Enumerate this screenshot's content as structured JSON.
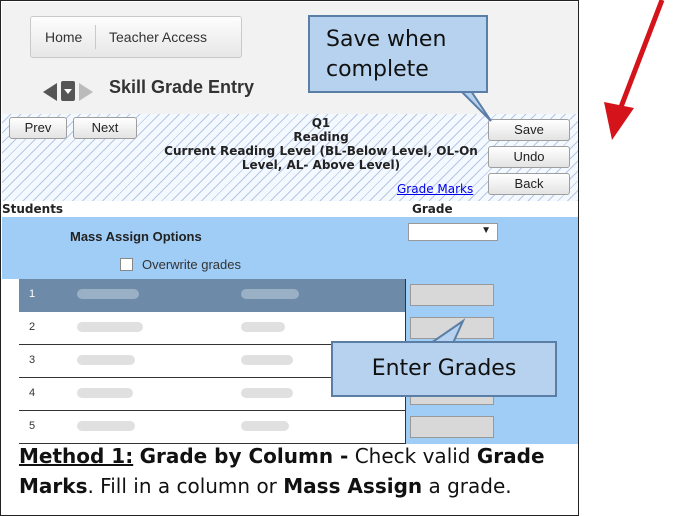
{
  "nav": {
    "home": "Home",
    "teacher_access": "Teacher Access"
  },
  "page_title": "Skill Grade Entry",
  "toolbar": {
    "prev": "Prev",
    "next": "Next",
    "save": "Save",
    "undo": "Undo",
    "back": "Back"
  },
  "heading": {
    "term": "Q1",
    "subject": "Reading",
    "skill": "Current Reading Level (BL-Below Level, OL-On Level, AL- Above Level)"
  },
  "grade_marks_link": "Grade Marks",
  "columns": {
    "students": "Students",
    "grade": "Grade"
  },
  "mass_assign": {
    "label": "Mass Assign Options",
    "overwrite": "Overwrite grades",
    "select_value": ""
  },
  "students": [
    {
      "num": "1"
    },
    {
      "num": "2"
    },
    {
      "num": "3"
    },
    {
      "num": "4"
    },
    {
      "num": "5"
    }
  ],
  "callouts": {
    "save": "Save when complete",
    "enter": "Enter Grades"
  },
  "caption": {
    "method": "Method 1:",
    "title": "Grade by Column -",
    "check": "Check valid",
    "grade_marks": "Grade Marks",
    "fill": ". Fill in a column or",
    "mass_assign": "Mass Assign",
    "end": "a grade."
  },
  "colors": {
    "blue_cell": "#9fcdf6",
    "selected_row": "#6d8aa8",
    "callout_fill": "#b7d2ee",
    "arrow": "#d4141a"
  }
}
